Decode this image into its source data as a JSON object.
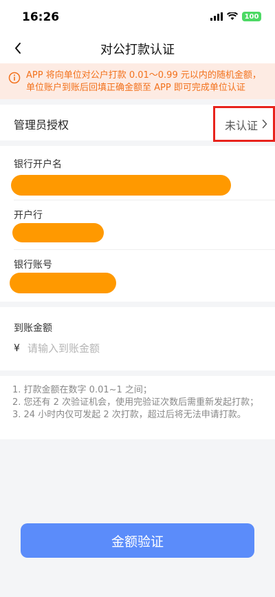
{
  "status_bar": {
    "time": "16:26",
    "battery": "100"
  },
  "nav": {
    "title": "对公打款认证",
    "back_icon": "chevron-left-icon"
  },
  "notice": {
    "icon": "info-icon",
    "text": "APP 将向单位对公户打款 0.01～0.99 元以内的随机金额，单位账户到账后回填正确金额至 APP 即可完成单位认证"
  },
  "admin": {
    "label": "管理员授权",
    "status": "未认证",
    "chevron_icon": "chevron-right-icon"
  },
  "fields": [
    {
      "label": "银行开户名"
    },
    {
      "label": "开户行"
    },
    {
      "label": "银行账号"
    }
  ],
  "amount": {
    "label": "到账金额",
    "currency": "¥",
    "placeholder": "请输入到账金额",
    "value": ""
  },
  "rules": [
    "1. 打款金额在数字 0.01~1 之间；",
    "2. 您还有 2 次验证机会，使用完验证次数后需重新发起打款；",
    "3. 24 小时内仅可发起 2 次打款，超过后将无法申请打款。"
  ],
  "submit_label": "金额验证",
  "colors": {
    "accent": "#5b8cfa",
    "warning": "#f2711c",
    "redaction": "#ff9900",
    "highlight": "#e8231c"
  }
}
